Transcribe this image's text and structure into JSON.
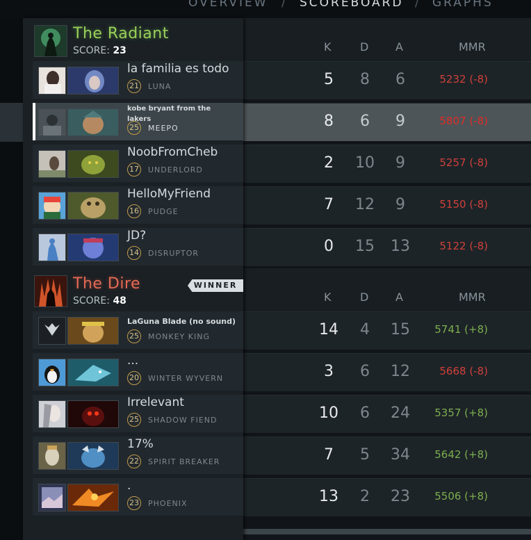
{
  "nav": {
    "tabs": [
      {
        "label": "OVERVIEW"
      },
      {
        "label": "SCOREBOARD"
      },
      {
        "label": "GRAPHS"
      }
    ],
    "separator": "/",
    "active": "SCOREBOARD"
  },
  "columns": {
    "k": "K",
    "d": "D",
    "a": "A",
    "mmr": "MMR"
  },
  "radiant": {
    "name": "The Radiant",
    "score_label": "SCORE:",
    "score": "23",
    "players": [
      {
        "name": "la familia es todo",
        "hero": "LUNA",
        "level": "21",
        "k": "5",
        "d": "8",
        "a": "6",
        "mmr": "5232 (-8)",
        "mmr_change": "negative"
      },
      {
        "name": "kobe bryant from the lakers",
        "hero": "MEEPO",
        "level": "25",
        "k": "8",
        "d": "6",
        "a": "9",
        "mmr": "5807 (-8)",
        "mmr_change": "negative"
      },
      {
        "name": "NoobFromCheb",
        "hero": "UNDERLORD",
        "level": "17",
        "k": "2",
        "d": "10",
        "a": "9",
        "mmr": "5257 (-8)",
        "mmr_change": "negative"
      },
      {
        "name": "HelloMyFriend",
        "hero": "PUDGE",
        "level": "16",
        "k": "7",
        "d": "12",
        "a": "9",
        "mmr": "5150 (-8)",
        "mmr_change": "negative"
      },
      {
        "name": "JD?",
        "hero": "DISRUPTOR",
        "level": "14",
        "k": "0",
        "d": "15",
        "a": "13",
        "mmr": "5122 (-8)",
        "mmr_change": "negative"
      }
    ]
  },
  "dire": {
    "name": "The Dire",
    "score_label": "SCORE:",
    "score": "48",
    "winner_label": "WINNER",
    "players": [
      {
        "name": "LaGuna Blade (no sound)",
        "hero": "MONKEY KING",
        "level": "25",
        "k": "14",
        "d": "4",
        "a": "15",
        "mmr": "5741 (+8)",
        "mmr_change": "positive"
      },
      {
        "name": "...",
        "hero": "WINTER WYVERN",
        "level": "20",
        "k": "3",
        "d": "6",
        "a": "12",
        "mmr": "5668 (-8)",
        "mmr_change": "negative"
      },
      {
        "name": "Irrelevant",
        "hero": "SHADOW FIEND",
        "level": "25",
        "k": "10",
        "d": "6",
        "a": "24",
        "mmr": "5357 (+8)",
        "mmr_change": "positive"
      },
      {
        "name": "17%",
        "hero": "SPIRIT BREAKER",
        "level": "22",
        "k": "7",
        "d": "5",
        "a": "34",
        "mmr": "5642 (+8)",
        "mmr_change": "positive"
      },
      {
        "name": ".",
        "hero": "PHOENIX",
        "level": "23",
        "k": "13",
        "d": "2",
        "a": "23",
        "mmr": "5506 (+8)",
        "mmr_change": "positive"
      }
    ]
  },
  "colors": {
    "radiant": "#9ad05a",
    "dire": "#e26a55",
    "mmr_negative": "#d0403a",
    "mmr_positive": "#7cae4e",
    "level_ring": "#c39b4d"
  }
}
